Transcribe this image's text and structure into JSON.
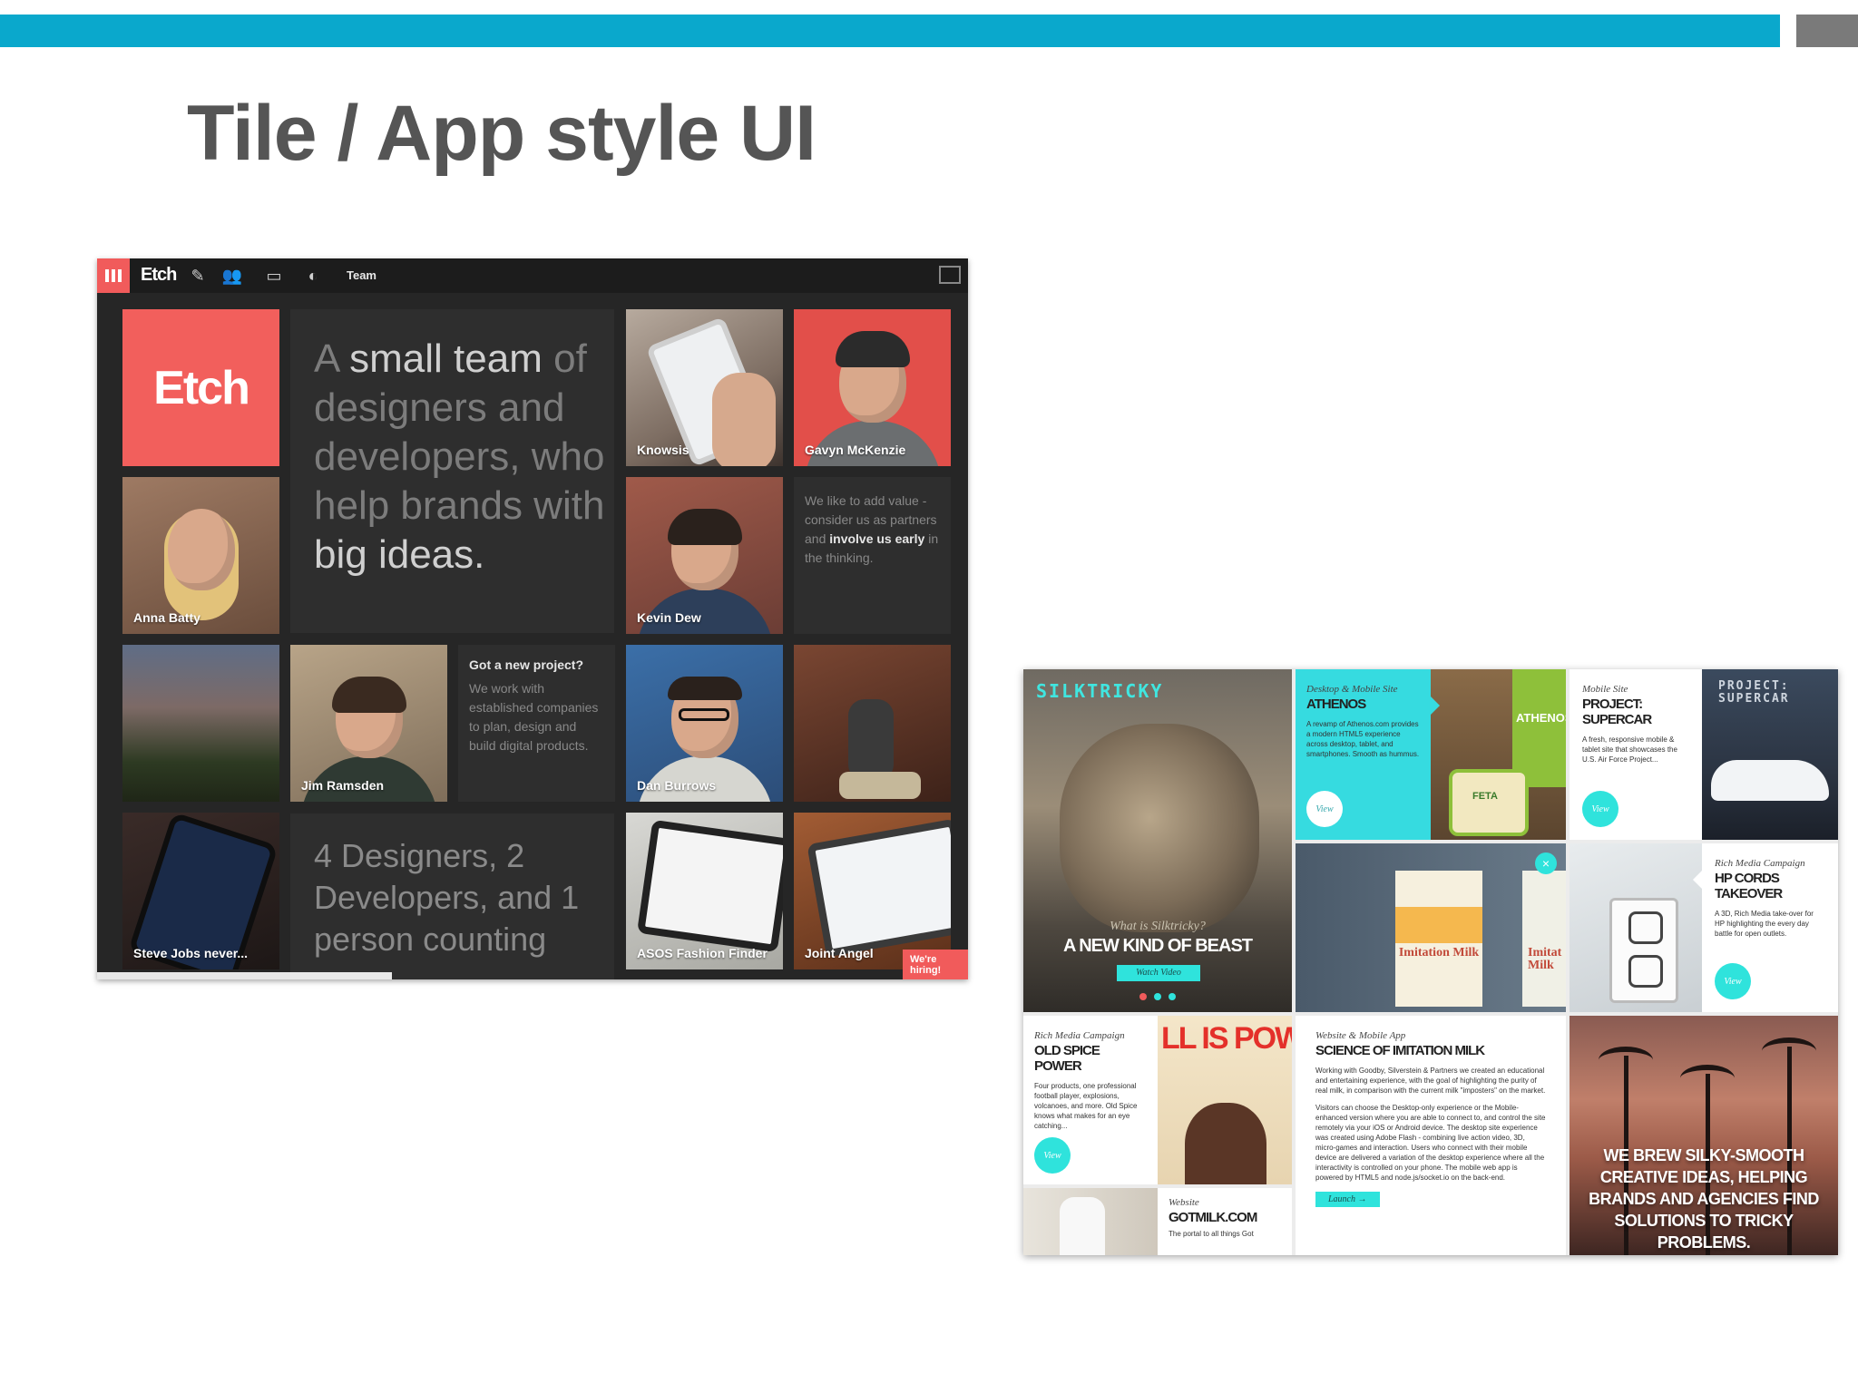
{
  "slide": {
    "title": "Tile / App style UI"
  },
  "etch": {
    "nav": {
      "logo": "Etch",
      "team": "Team"
    },
    "logo_tile": "Etch",
    "intro": {
      "dim1": "A ",
      "bright1": "small team",
      "dim2": " of designers and developers, who help brands with ",
      "bright2": "big ideas."
    },
    "tiles": {
      "knowsis": "Knowsis",
      "gavyn": "Gavyn McKenzie",
      "anna": "Anna Batty",
      "kevin": "Kevin Dew",
      "jim": "Jim Ramsden",
      "dan": "Dan Burrows",
      "steve": "Steve Jobs never...",
      "asos": "ASOS Fashion Finder",
      "joint": "Joint Angel"
    },
    "value": {
      "dim1": "We like to add value - consider us as partners and ",
      "bright1": "involve us early",
      "dim2": " in the thinking."
    },
    "project": {
      "title": "Got a new project?",
      "body": "We work with established companies to plan, design and build digital products."
    },
    "count": "4 Designers, 2 Developers, and 1 person counting",
    "hiring": "We're hiring!"
  },
  "silk": {
    "brand": "SILKTRICKY",
    "beast": {
      "question": "What is Silktricky?",
      "headline": "A NEW KIND OF BEAST",
      "button": "Watch Video"
    },
    "athenos": {
      "label": "Desktop & Mobile Site",
      "title": "ATHENOS",
      "text": "A revamp of Athenos.com provides a modern HTML5 experience across desktop, tablet, and smartphones. Smooth as hummus.",
      "view": "View",
      "package": "ATHENOS",
      "feta": "FETA"
    },
    "supercar": {
      "label": "Mobile Site",
      "title": "PROJECT: SUPERCAR",
      "text": "A fresh, responsive mobile & tablet site that showcases the U.S. Air Force Project...",
      "view": "View",
      "banner": "PROJECT: SUPERCAR"
    },
    "milk_cartons": {
      "left": "Imitation Milk",
      "right": "Imitat Milk"
    },
    "hpcords": {
      "label": "Rich Media Campaign",
      "title": "HP CORDS TAKEOVER",
      "text": "A 3D, Rich Media take-over for HP highlighting the every day battle for open outlets.",
      "view": "View"
    },
    "oldspice": {
      "label": "Rich Media Campaign",
      "title": "OLD SPICE POWER",
      "text": "Four products, one professional football player, explosions, volcanoes, and more. Old Spice knows what makes for an eye catching...",
      "view": "View",
      "poster": "LL IS POW"
    },
    "imitation": {
      "label": "Website & Mobile App",
      "title": "SCIENCE OF IMITATION MILK",
      "p1": "Working with Goodby, Silverstein & Partners we created an educational and entertaining experience, with the goal of highlighting the purity of real milk, in comparison with the current milk \"imposters\" on the market.",
      "p2": "Visitors can choose the Desktop-only experience or the Mobile-enhanced version where you are able to connect to, and control the site remotely via your iOS or Android device. The desktop site experience was created using Adobe Flash - combining live action video, 3D, micro-games and interaction. Users who connect with their mobile device are delivered a variation of the desktop experience where all the interactivity is controlled on your phone. The mobile web app is powered by HTML5 and node.js/socket.io on the back-end.",
      "launch": "Launch →"
    },
    "brew": "WE BREW SILKY-SMOOTH CREATIVE IDEAS, HELPING BRANDS AND AGENCIES FIND SOLUTIONS TO TRICKY PROBLEMS.",
    "gotmilk": {
      "label": "Website",
      "title": "GOTMILK.COM",
      "text": "The portal to all things Got"
    }
  }
}
